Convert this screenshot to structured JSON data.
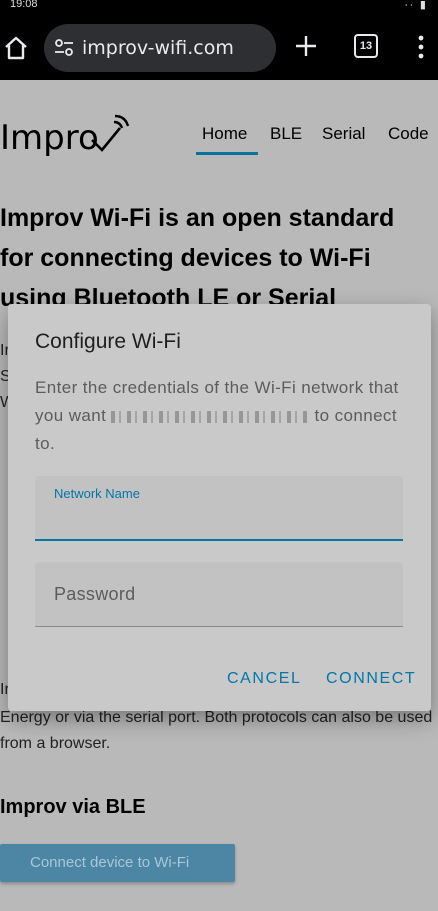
{
  "status_bar": {
    "time": "19:08",
    "system": "∙∙ ▮"
  },
  "browser": {
    "url": "improv-wifi.com",
    "tab_count": "13"
  },
  "page": {
    "logo_text": "Impro",
    "nav": [
      "Home",
      "BLE",
      "Serial",
      "Code"
    ],
    "headline": "Improv Wi-Fi is an open standard for connecting devices to Wi-Fi using Bluetooth LE or Serial",
    "frag_left": [
      "Ir",
      "S",
      "W"
    ],
    "body_frag_1": "Ir",
    "body_line_2": "Energy or via the serial port. Both protocols can also be used from a browser.",
    "subheading": "Improv via BLE",
    "cta_label": "Connect device to Wi-Fi"
  },
  "dialog": {
    "title": "Configure Wi-Fi",
    "message_before": "Enter the credentials of the Wi-Fi network that you want",
    "message_after": "to connect to.",
    "network_label": "Network Name",
    "network_value": "",
    "password_label": "Password",
    "password_value": "",
    "cancel": "CANCEL",
    "connect": "CONNECT"
  },
  "colors": {
    "accent": "#0277a8",
    "dialog_bg": "#c9c9c9",
    "scrim_page": "#b9b9b9"
  }
}
